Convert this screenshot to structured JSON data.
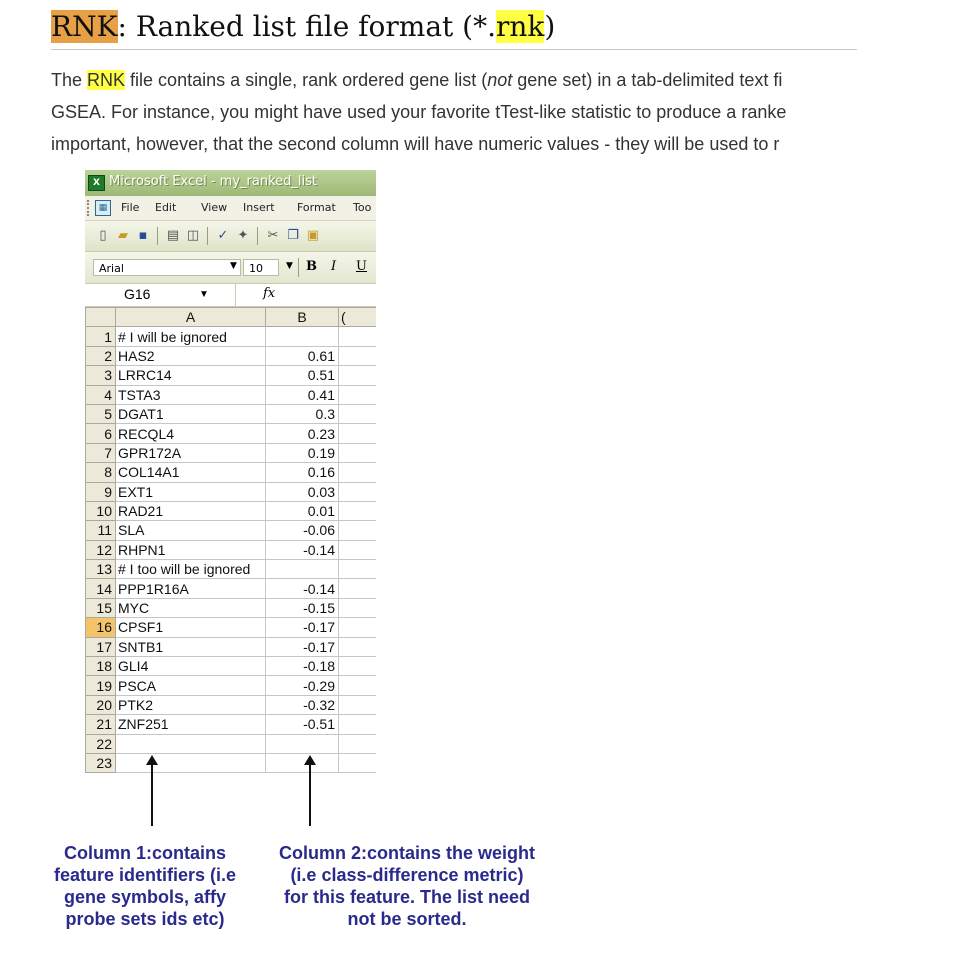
{
  "heading": {
    "prefix": "RNK",
    "middle": ": Ranked list file format (*.",
    "suffix_hl": "rnk",
    "end": ")"
  },
  "intro": {
    "l1_pre": "The ",
    "l1_kw": "RNK",
    "l1_mid": " file contains a single, rank ordered gene list (",
    "l1_em": "not",
    "l1_post": " gene set) in a tab-delimited text fi",
    "l2": "GSEA. For instance, you might have used your favorite tTest-like statistic to produce a ranke",
    "l3": "important, however, that the second column will have numeric values - they will be used to r"
  },
  "excel": {
    "window_title": "Microsoft Excel - my_ranked_list",
    "menu": [
      "File",
      "Edit",
      "View",
      "Insert",
      "Format",
      "Too"
    ],
    "font_name": "Arial",
    "font_size": "10",
    "bold": "B",
    "italic": "I",
    "underline": "U",
    "name_box": "G16",
    "fx": "fx",
    "col_headers": [
      "A",
      "B",
      "("
    ],
    "rows": [
      {
        "n": "1",
        "a": "# I will be ignored",
        "b": ""
      },
      {
        "n": "2",
        "a": "HAS2",
        "b": "0.61"
      },
      {
        "n": "3",
        "a": "LRRC14",
        "b": "0.51"
      },
      {
        "n": "4",
        "a": "TSTA3",
        "b": "0.41"
      },
      {
        "n": "5",
        "a": "DGAT1",
        "b": "0.3"
      },
      {
        "n": "6",
        "a": "RECQL4",
        "b": "0.23"
      },
      {
        "n": "7",
        "a": "GPR172A",
        "b": "0.19"
      },
      {
        "n": "8",
        "a": "COL14A1",
        "b": "0.16"
      },
      {
        "n": "9",
        "a": "EXT1",
        "b": "0.03"
      },
      {
        "n": "10",
        "a": "RAD21",
        "b": "0.01"
      },
      {
        "n": "11",
        "a": "SLA",
        "b": "-0.06"
      },
      {
        "n": "12",
        "a": "RHPN1",
        "b": "-0.14"
      },
      {
        "n": "13",
        "a": "# I too will be ignored",
        "b": ""
      },
      {
        "n": "14",
        "a": "PPP1R16A",
        "b": "-0.14"
      },
      {
        "n": "15",
        "a": "MYC",
        "b": "-0.15"
      },
      {
        "n": "16",
        "a": "CPSF1",
        "b": "-0.17"
      },
      {
        "n": "17",
        "a": "SNTB1",
        "b": "-0.17"
      },
      {
        "n": "18",
        "a": "GLI4",
        "b": "-0.18"
      },
      {
        "n": "19",
        "a": "PSCA",
        "b": "-0.29"
      },
      {
        "n": "20",
        "a": "PTK2",
        "b": "-0.32"
      },
      {
        "n": "21",
        "a": "ZNF251",
        "b": "-0.51"
      },
      {
        "n": "22",
        "a": "",
        "b": ""
      },
      {
        "n": "23",
        "a": "",
        "b": ""
      }
    ],
    "selected_row": "16",
    "colors": {
      "selected_header": "#f5c46a",
      "title_bar": "#9eb877"
    }
  },
  "captions": {
    "col1": [
      "Column 1:contains",
      "feature identifiers (i.e",
      "gene symbols, affy",
      "probe sets ids etc)"
    ],
    "col2": [
      "Column 2:contains the weight",
      "(i.e class-difference metric)",
      "for this feature. The list need",
      "not be sorted."
    ]
  }
}
